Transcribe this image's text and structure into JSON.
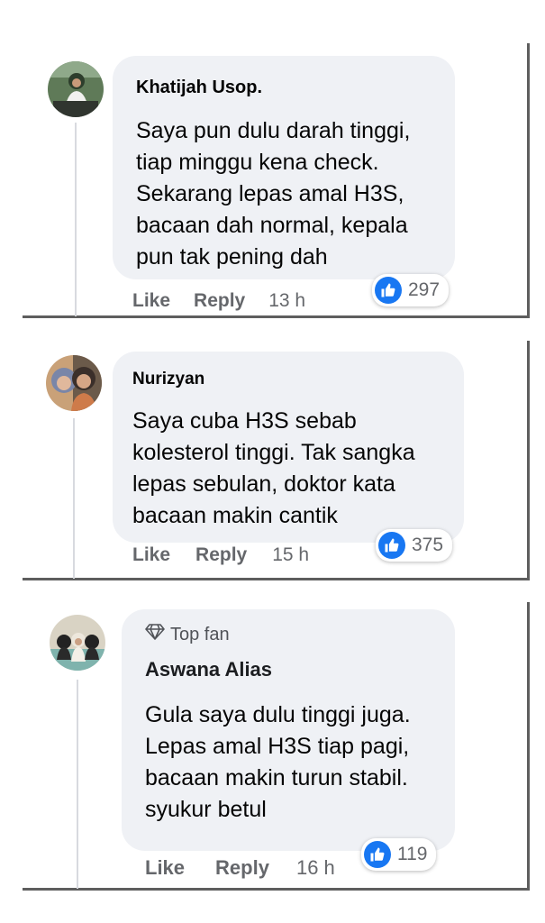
{
  "comments": [
    {
      "author": "Khatijah Usop.",
      "text": "Saya pun dulu darah tinggi,\ntiap minggu kena check.\nSekarang lepas amal H3S,\nbacaan dah normal, kepala\npun tak pening dah",
      "like_label": "Like",
      "reply_label": "Reply",
      "time": "13 h",
      "reaction_count": "297"
    },
    {
      "author": "Nurizyan",
      "text": "Saya cuba H3S sebab\nkolesterol tinggi. Tak sangka\nlepas sebulan, doktor kata\nbacaan makin cantik",
      "like_label": "Like",
      "reply_label": "Reply",
      "time": "15 h",
      "reaction_count": "375"
    },
    {
      "badge": "Top fan",
      "author": "Aswana Alias",
      "text": "Gula saya dulu tinggi juga.\nLepas amal H3S tiap pagi,\nbacaan makin turun stabil.\nsyukur betul",
      "like_label": "Like",
      "reply_label": "Reply",
      "time": "16 h",
      "reaction_count": "119"
    }
  ],
  "colors": {
    "bubble": "#eff1f5",
    "like_blue": "#1877f2",
    "meta_gray": "#65676b",
    "frame": "#5e5e5e"
  },
  "icons": [
    "thumbs-up-icon",
    "diamond-icon"
  ]
}
